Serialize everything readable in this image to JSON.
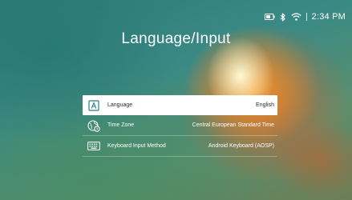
{
  "status": {
    "time": "2:34 PM",
    "icons": [
      "battery-icon",
      "bluetooth-icon",
      "wifi-icon"
    ]
  },
  "title": "Language/Input",
  "menu": {
    "items": [
      {
        "icon": "language-icon",
        "label": "Language",
        "value": "English",
        "selected": true
      },
      {
        "icon": "time-zone-icon",
        "label": "Time Zone",
        "value": "Central European Standard Time",
        "selected": false
      },
      {
        "icon": "keyboard-icon",
        "label": "Keyboard Input Method",
        "value": "Android Keyboard (AOSP)",
        "selected": false
      }
    ]
  },
  "colors": {
    "selected_bg": "#ffffff",
    "selected_text": "#1e2a2e",
    "accent": "#2a7b8c",
    "text": "#ffffff"
  }
}
